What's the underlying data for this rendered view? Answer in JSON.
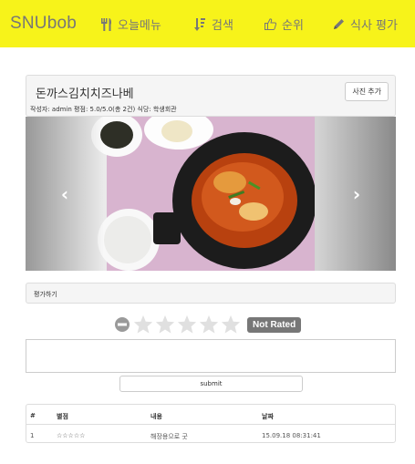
{
  "navbar": {
    "brand": "SNUbob",
    "items": [
      {
        "icon": "fork-knife-icon",
        "label": "오늘메뉴"
      },
      {
        "icon": "sort-icon",
        "label": "검색"
      },
      {
        "icon": "thumbs-up-icon",
        "label": "순위"
      },
      {
        "icon": "pencil-icon",
        "label": "식사 평가"
      }
    ],
    "background": "#f7f31a"
  },
  "food": {
    "title": "돈까스김치치즈나베",
    "photo_button": "사진 추가",
    "meta": "작성자: admin  평점: 5.0/5.0(총 2건)  식당: 학생회관"
  },
  "carousel": {
    "prev_icon": "chevron-left-icon",
    "next_icon": "chevron-right-icon"
  },
  "rating": {
    "title": "평가하기",
    "status": "Not Rated",
    "clear_icon": "minus-circle-icon",
    "max_stars": 5,
    "textarea_placeholder": "",
    "submit_label": "submit"
  },
  "reviews": {
    "headers": {
      "num": "#",
      "stars": "별점",
      "content": "내용",
      "date": "날짜"
    },
    "rows": [
      {
        "num": "1",
        "stars": "☆☆☆☆☆",
        "content": "해장용으로 굿",
        "date": "15.09.18 08:31:41"
      }
    ]
  }
}
